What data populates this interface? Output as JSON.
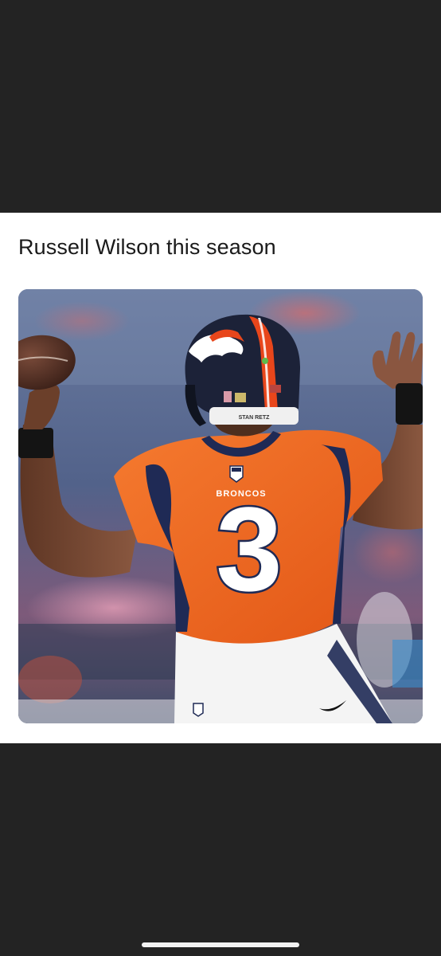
{
  "post": {
    "caption": "Russell Wilson this season"
  },
  "photo": {
    "jersey_number": "3",
    "jersey_wordmark": "BRONCOS",
    "helmet_decal_text": "STAN RETZ",
    "colors": {
      "jersey_orange": "#f0661f",
      "navy_trim": "#1f2a55",
      "helmet_navy": "#1c2238",
      "stripe_orange": "#e8461b",
      "skin": "#7a4a33",
      "stadium_blue": "#5a6c92"
    }
  }
}
